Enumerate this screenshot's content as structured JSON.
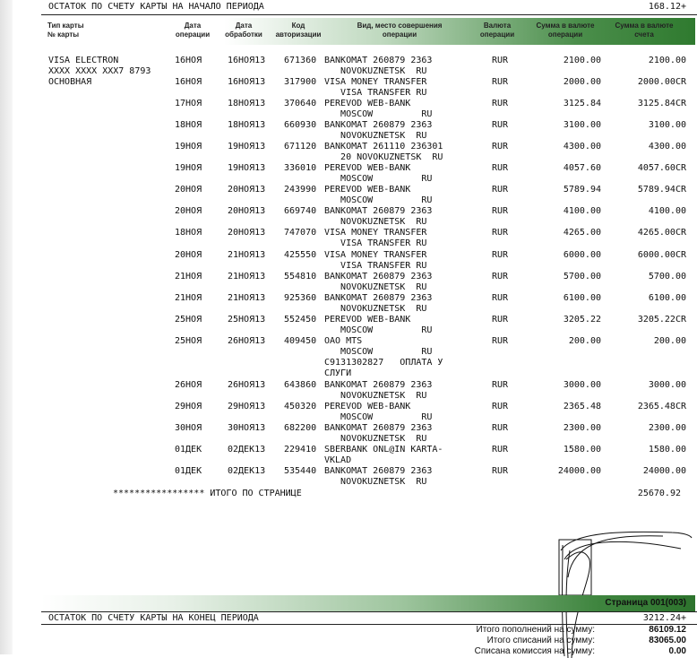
{
  "opening": {
    "label": "ОСТАТОК ПО СЧЕТУ КАРТЫ НА НАЧАЛО ПЕРИОДА",
    "amount": "168.12+"
  },
  "header": {
    "card_type": "Тип карты\n№ карты",
    "op_date": "Дата\nоперации",
    "proc_date": "Дата\nобработки",
    "auth_code": "Код\nавторизации",
    "description": "Вид, место совершения\nоперации",
    "currency": "Валюта\nоперации",
    "amount_op": "Сумма в валюте\nоперации",
    "amount_acc": "Сумма в валюте\nсчета"
  },
  "card": {
    "type": "VISA ELECTRON",
    "number": "XXXX XXXX XXX7 8793",
    "kind": "ОСНОВНАЯ"
  },
  "transactions": [
    {
      "d1": "16НОЯ",
      "d2": "16НОЯ13",
      "code": "671360",
      "desc1": "BANKOMAT 260879 2363",
      "desc2": "   NOVOKUZNETSK  RU",
      "cur": "RUR",
      "amt": "2100.00",
      "amt2": "2100.00"
    },
    {
      "d1": "16НОЯ",
      "d2": "16НОЯ13",
      "code": "317900",
      "desc1": "VISA MONEY TRANSFER",
      "desc2": "   VISA TRANSFER RU",
      "cur": "RUR",
      "amt": "2000.00",
      "amt2": "2000.00CR"
    },
    {
      "d1": "17НОЯ",
      "d2": "18НОЯ13",
      "code": "370640",
      "desc1": "PEREVOD WEB-BANK",
      "desc2": "   MOSCOW         RU",
      "cur": "RUR",
      "amt": "3125.84",
      "amt2": "3125.84CR"
    },
    {
      "d1": "18НОЯ",
      "d2": "18НОЯ13",
      "code": "660930",
      "desc1": "BANKOMAT 260879 2363",
      "desc2": "   NOVOKUZNETSK  RU",
      "cur": "RUR",
      "amt": "3100.00",
      "amt2": "3100.00"
    },
    {
      "d1": "19НОЯ",
      "d2": "19НОЯ13",
      "code": "671120",
      "desc1": "BANKOMAT 261110 236301",
      "desc2": "   20 NOVOKUZNETSK  RU",
      "cur": "RUR",
      "amt": "4300.00",
      "amt2": "4300.00"
    },
    {
      "d1": "19НОЯ",
      "d2": "19НОЯ13",
      "code": "336010",
      "desc1": "PEREVOD WEB-BANK",
      "desc2": "   MOSCOW         RU",
      "cur": "RUR",
      "amt": "4057.60",
      "amt2": "4057.60CR"
    },
    {
      "d1": "20НОЯ",
      "d2": "20НОЯ13",
      "code": "243990",
      "desc1": "PEREVOD WEB-BANK",
      "desc2": "   MOSCOW         RU",
      "cur": "RUR",
      "amt": "5789.94",
      "amt2": "5789.94CR"
    },
    {
      "d1": "20НОЯ",
      "d2": "20НОЯ13",
      "code": "669740",
      "desc1": "BANKOMAT 260879 2363",
      "desc2": "   NOVOKUZNETSK  RU",
      "cur": "RUR",
      "amt": "4100.00",
      "amt2": "4100.00"
    },
    {
      "d1": "18НОЯ",
      "d2": "20НОЯ13",
      "code": "747070",
      "desc1": "VISA MONEY TRANSFER",
      "desc2": "   VISA TRANSFER RU",
      "cur": "RUR",
      "amt": "4265.00",
      "amt2": "4265.00CR"
    },
    {
      "d1": "20НОЯ",
      "d2": "21НОЯ13",
      "code": "425550",
      "desc1": "VISA MONEY TRANSFER",
      "desc2": "   VISA TRANSFER RU",
      "cur": "RUR",
      "amt": "6000.00",
      "amt2": "6000.00CR"
    },
    {
      "d1": "21НОЯ",
      "d2": "21НОЯ13",
      "code": "554810",
      "desc1": "BANKOMAT 260879 2363",
      "desc2": "   NOVOKUZNETSK  RU",
      "cur": "RUR",
      "amt": "5700.00",
      "amt2": "5700.00"
    },
    {
      "d1": "21НОЯ",
      "d2": "21НОЯ13",
      "code": "925360",
      "desc1": "BANKOMAT 260879 2363",
      "desc2": "   NOVOKUZNETSK  RU",
      "cur": "RUR",
      "amt": "6100.00",
      "amt2": "6100.00"
    },
    {
      "d1": "25НОЯ",
      "d2": "25НОЯ13",
      "code": "552450",
      "desc1": "PEREVOD WEB-BANK",
      "desc2": "   MOSCOW         RU",
      "cur": "RUR",
      "amt": "3205.22",
      "amt2": "3205.22CR"
    },
    {
      "d1": "25НОЯ",
      "d2": "26НОЯ13",
      "code": "409450",
      "desc1": "ОАО MTS",
      "desc2": "   MOSCOW         RU",
      "desc3": "C9131302827   ОПЛАТА У",
      "desc4": "СЛУГИ",
      "cur": "RUR",
      "amt": "200.00",
      "amt2": "200.00"
    },
    {
      "d1": "26НОЯ",
      "d2": "26НОЯ13",
      "code": "643860",
      "desc1": "BANKOMAT 260879 2363",
      "desc2": "   NOVOKUZNETSK  RU",
      "cur": "RUR",
      "amt": "3000.00",
      "amt2": "3000.00"
    },
    {
      "d1": "29НОЯ",
      "d2": "29НОЯ13",
      "code": "450320",
      "desc1": "PEREVOD WEB-BANK",
      "desc2": "   MOSCOW         RU",
      "cur": "RUR",
      "amt": "2365.48",
      "amt2": "2365.48CR"
    },
    {
      "d1": "30НОЯ",
      "d2": "30НОЯ13",
      "code": "682200",
      "desc1": "BANKOMAT 260879 2363",
      "desc2": "   NOVOKUZNETSK  RU",
      "cur": "RUR",
      "amt": "2300.00",
      "amt2": "2300.00"
    },
    {
      "d1": "01ДЕК",
      "d2": "02ДЕК13",
      "code": "229410",
      "desc1": "SBERBANK ONL@IN KARTA-",
      "desc2": "VKLAD",
      "cur": "RUR",
      "amt": "1580.00",
      "amt2": "1580.00"
    },
    {
      "d1": "01ДЕК",
      "d2": "02ДЕК13",
      "code": "535440",
      "desc1": "BANKOMAT 260879 2363",
      "desc2": "   NOVOKUZNETSK  RU",
      "cur": "RUR",
      "amt": "24000.00",
      "amt2": "24000.00"
    }
  ],
  "page_total": {
    "label": "***************** ИТОГО ПО СТРАНИЦЕ",
    "amount": "25670.92"
  },
  "page_number": "Страница 001(003)",
  "closing": {
    "label": "ОСТАТОК ПО СЧЕТУ КАРТЫ НА КОНЕЦ ПЕРИОДА",
    "amount": "3212.24+"
  },
  "summary": [
    {
      "label": "Итого пополнений на сумму:",
      "value": "86109.12"
    },
    {
      "label": "Итого списаний на сумму:",
      "value": "83065.00"
    },
    {
      "label": "Списана комиссия на сумму:",
      "value": "0.00"
    }
  ],
  "colors": {
    "header_green": "#2f7a2f",
    "light_green": "#bfd9bf"
  }
}
